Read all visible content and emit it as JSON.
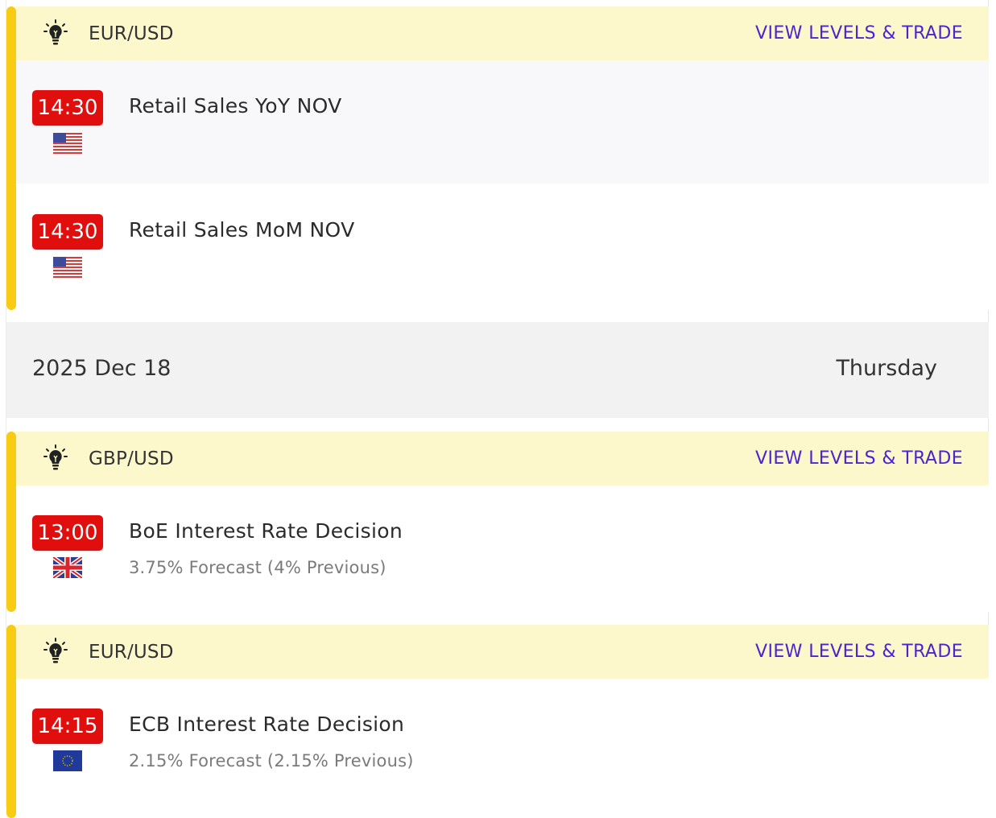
{
  "groups": [
    {
      "pair": "EUR/USD",
      "trade_label": "VIEW LEVELS & TRADE",
      "events": [
        {
          "time": "14:30",
          "title": "Retail Sales YoY NOV",
          "subtitle": "",
          "flag": "us-flag-icon"
        },
        {
          "time": "14:30",
          "title": "Retail Sales MoM NOV",
          "subtitle": "",
          "flag": "us-flag-icon"
        }
      ]
    },
    {
      "pair": "GBP/USD",
      "trade_label": "VIEW LEVELS & TRADE",
      "events": [
        {
          "time": "13:00",
          "title": "BoE Interest Rate Decision",
          "subtitle": "3.75% Forecast (4% Previous)",
          "flag": "uk-flag-icon"
        }
      ]
    },
    {
      "pair": "EUR/USD",
      "trade_label": "VIEW LEVELS & TRADE",
      "events": [
        {
          "time": "14:15",
          "title": "ECB Interest Rate Decision",
          "subtitle": "2.15% Forecast (2.15% Previous)",
          "flag": "eu-flag-icon"
        }
      ]
    }
  ],
  "date_row": {
    "date": "2025 Dec 18",
    "weekday": "Thursday"
  },
  "colors": {
    "accent_bar": "#f8cc12",
    "header_bg": "#fdf8cc",
    "time_badge": "#e10e0e",
    "trade_link": "#4a24d1",
    "date_row_bg": "#f2f2f3"
  }
}
